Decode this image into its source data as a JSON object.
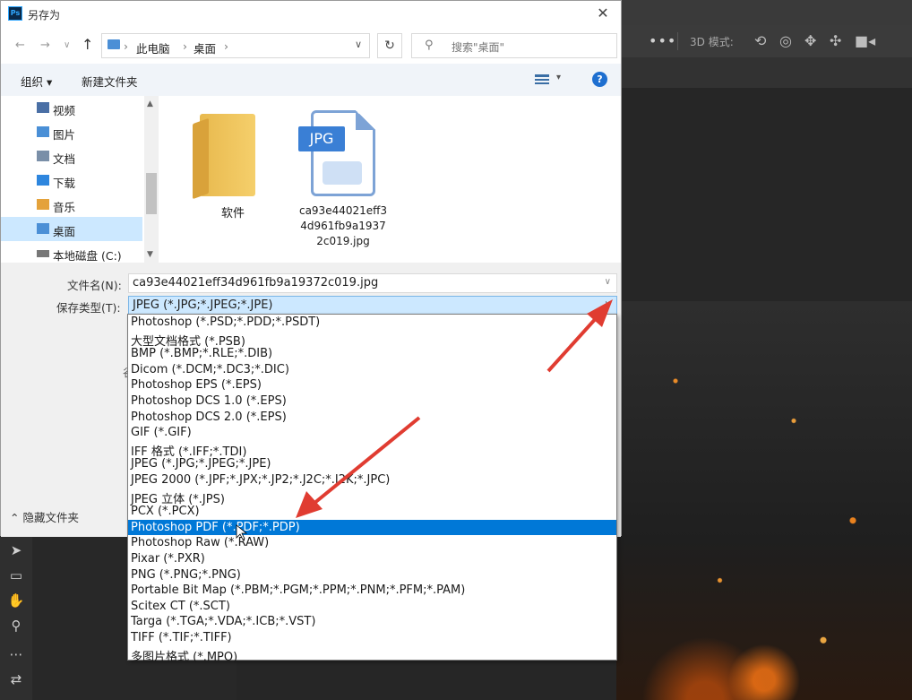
{
  "dialog": {
    "title": "另存为",
    "close": "✕"
  },
  "nav": {
    "back": "←",
    "forward": "→",
    "up": "↑",
    "crumbs": [
      "此电脑",
      "桌面"
    ],
    "sep": "›",
    "refresh": "↻",
    "search_placeholder": "搜索\"桌面\""
  },
  "cmd": {
    "organize": "组织 ▾",
    "new_folder": "新建文件夹",
    "help": "?"
  },
  "sidebar": {
    "items": [
      {
        "label": "视频",
        "icon": "video-folder-icon",
        "color": "#4a6fa5"
      },
      {
        "label": "图片",
        "icon": "pictures-folder-icon",
        "color": "#4a8fd6"
      },
      {
        "label": "文档",
        "icon": "documents-folder-icon",
        "color": "#7a8fa8"
      },
      {
        "label": "下载",
        "icon": "downloads-folder-icon",
        "color": "#2e86de"
      },
      {
        "label": "音乐",
        "icon": "music-folder-icon",
        "color": "#e4a23b"
      },
      {
        "label": "桌面",
        "icon": "desktop-folder-icon",
        "color": "#4b8fd6"
      },
      {
        "label": "本地磁盘 (C:)",
        "icon": "drive-icon",
        "color": "#777777"
      }
    ],
    "selected_index": 5
  },
  "files": [
    {
      "name": "软件",
      "type": "folder"
    },
    {
      "name_lines": [
        "ca93e44021eff3",
        "4d961fb9a1937",
        "2c019.jpg"
      ],
      "type": "jpg",
      "tag": "JPG"
    }
  ],
  "form": {
    "filename_label": "文件名(N):",
    "filename_value": "ca93e44021eff34d961fb9a19372c019.jpg",
    "filetype_label": "保存类型(T):",
    "filetype_value": "JPEG (*.JPG;*.JPEG;*.JPE)",
    "stray_char": "谷",
    "hide_folders": "⌃ 隐藏文件夹"
  },
  "dropdown": {
    "options": [
      "Photoshop (*.PSD;*.PDD;*.PSDT)",
      "大型文档格式 (*.PSB)",
      "BMP (*.BMP;*.RLE;*.DIB)",
      "Dicom (*.DCM;*.DC3;*.DIC)",
      "Photoshop EPS (*.EPS)",
      "Photoshop DCS 1.0 (*.EPS)",
      "Photoshop DCS 2.0 (*.EPS)",
      "GIF (*.GIF)",
      "IFF 格式 (*.IFF;*.TDI)",
      "JPEG (*.JPG;*.JPEG;*.JPE)",
      "JPEG 2000 (*.JPF;*.JPX;*.JP2;*.J2C;*.J2K;*.JPC)",
      "JPEG 立体 (*.JPS)",
      "PCX (*.PCX)",
      "Photoshop PDF (*.PDF;*.PDP)",
      "Photoshop Raw (*.RAW)",
      "Pixar (*.PXR)",
      "PNG (*.PNG;*.PNG)",
      "Portable Bit Map (*.PBM;*.PGM;*.PPM;*.PNM;*.PFM;*.PAM)",
      "Scitex CT (*.SCT)",
      "Targa (*.TGA;*.VDA;*.ICB;*.VST)",
      "TIFF (*.TIF;*.TIFF)",
      "多图片格式 (*.MPO)"
    ],
    "selected_index": 13
  },
  "photoshop": {
    "mode_label": "3D 模式:",
    "dots": "•••",
    "accent": "#e03c31"
  }
}
